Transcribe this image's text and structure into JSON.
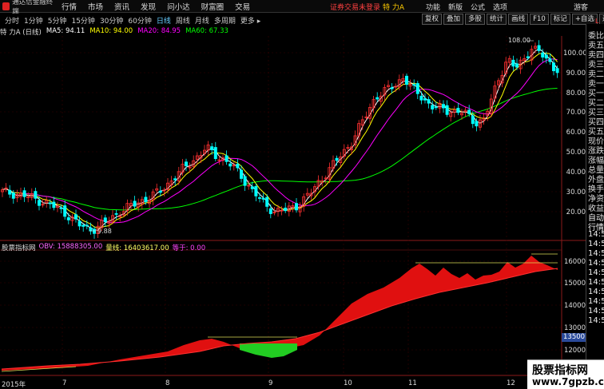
{
  "app": {
    "logo_text": "通达信金融终端"
  },
  "menu": [
    "行情",
    "市场",
    "资讯",
    "发现",
    "问小达",
    "财富圈",
    "交易"
  ],
  "alert": {
    "text": "证券交易未登录",
    "stock": "特 力A"
  },
  "right_menu": [
    "功能",
    "新版",
    "公式",
    "选项"
  ],
  "guest": "游客",
  "periods": [
    "分时",
    "1分钟",
    "5分钟",
    "15分钟",
    "30分钟",
    "60分钟",
    "日线",
    "周线",
    "月线",
    "多周期",
    "更多 ▸"
  ],
  "active_period": "日线",
  "toolbar": [
    "复权",
    "叠加",
    "多股",
    "统计",
    "画线",
    "F10",
    "标记",
    "+自选",
    "返回"
  ],
  "ma_legend": {
    "title": "特 力A (日线)",
    "ma5": "MA5: 94.11",
    "ma10": "MA10: 94.00",
    "ma20": "MA20: 84.95",
    "ma60": "MA60: 67.33"
  },
  "colors": {
    "ma5": "#ffffff",
    "ma10": "#ffff00",
    "ma20": "#ff00ff",
    "ma60": "#00ff00",
    "up": "#ff3030",
    "down": "#00ffff"
  },
  "price_axis": [
    "100.00",
    "90.00",
    "80.00",
    "70.00",
    "60.00",
    "50.00",
    "40.00",
    "30.00",
    "20.00"
  ],
  "annotations": {
    "high": "108.00",
    "low": "9.88"
  },
  "indicator_legend": {
    "name": "股票指标网",
    "obv": "OBV: 15888305.00",
    "vol_line": "量线: 16403617.00",
    "eq": "等于: 0.00"
  },
  "indicator_axis": [
    "16000",
    "15000",
    "14000",
    "13000",
    "12000"
  ],
  "indicator_price_box": "13500",
  "right_panel": [
    "委比",
    "卖五",
    "卖四",
    "卖三",
    "卖二",
    "卖一",
    "买一",
    "买二",
    "买三",
    "买四",
    "买五",
    "现价",
    "涨跌",
    "涨幅",
    "总量",
    "外盘",
    "换手",
    "净资",
    "收益",
    "自动",
    "行情",
    "14:50",
    "14:50",
    "14:50",
    "14:50",
    "14:50",
    "14:50",
    "14:50",
    "14:50",
    "14:50",
    "14:50"
  ],
  "right_corner": "L",
  "x_axis": [
    "2015年",
    "7",
    "8",
    "9",
    "10",
    "11",
    "12"
  ],
  "watermark": {
    "line1": "股票指标网",
    "line2": "www.7gpzb.com"
  }
}
